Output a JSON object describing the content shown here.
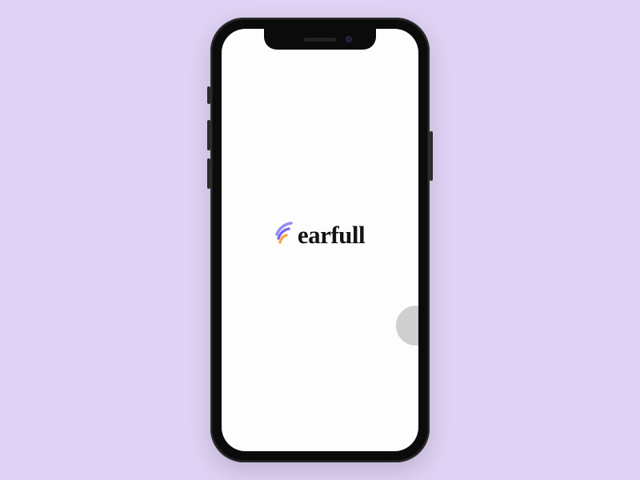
{
  "app": {
    "name": "earfull"
  },
  "logo": {
    "arc_colors": {
      "inner": "#f4a93b",
      "middle": "#7b68ee",
      "outer": "#938bf0"
    },
    "wordmark_color": "#141414"
  },
  "device": {
    "frame_color": "#1a1a1a",
    "screen_bg": "#fdfdfd"
  },
  "background": {
    "page_color": "#dfd2f4"
  }
}
